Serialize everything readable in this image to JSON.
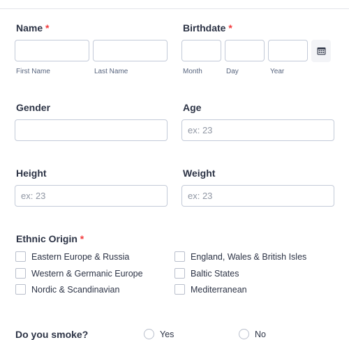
{
  "name": {
    "label": "Name",
    "required_mark": "*",
    "first_value": "",
    "last_value": "",
    "first_sub": "First Name",
    "last_sub": "Last Name"
  },
  "birthdate": {
    "label": "Birthdate",
    "required_mark": "*",
    "month_value": "",
    "day_value": "",
    "year_value": "",
    "month_sub": "Month",
    "day_sub": "Day",
    "year_sub": "Year",
    "calendar_icon": "calendar-icon"
  },
  "gender": {
    "label": "Gender",
    "value": ""
  },
  "age": {
    "label": "Age",
    "placeholder": "ex: 23",
    "value": ""
  },
  "height": {
    "label": "Height",
    "placeholder": "ex: 23",
    "value": ""
  },
  "weight": {
    "label": "Weight",
    "placeholder": "ex: 23",
    "value": ""
  },
  "ethnic_origin": {
    "label": "Ethnic Origin",
    "required_mark": "*",
    "options": [
      "Eastern Europe & Russia",
      "Western & Germanic Europe",
      "Nordic & Scandinavian",
      "England, Wales & British Isles",
      "Baltic States",
      "Mediterranean"
    ]
  },
  "smoke": {
    "label": "Do you smoke?",
    "options": [
      "Yes",
      "No"
    ]
  },
  "colors": {
    "text": "#2c3345",
    "required": "#f23a3c",
    "border": "#c3cad8",
    "sublabel": "#57647e",
    "placeholder": "#8f96a3"
  }
}
